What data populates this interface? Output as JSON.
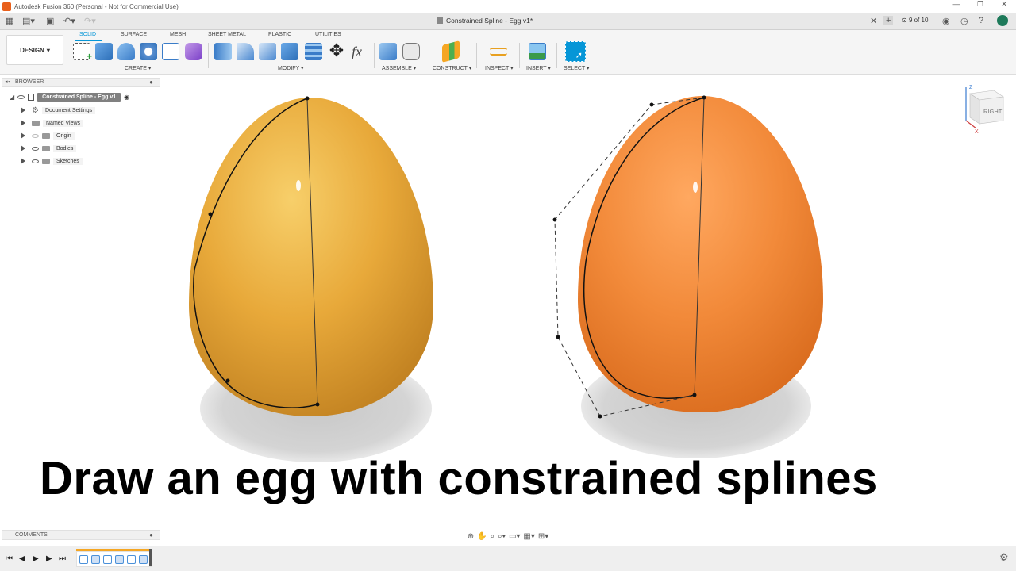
{
  "window": {
    "title": "Autodesk Fusion 360 (Personal - Not for Commercial Use)"
  },
  "document": {
    "tab_title": "Constrained Spline - Egg v1*",
    "pager": "9 of 10"
  },
  "workspace": {
    "design_label": "DESIGN"
  },
  "menu_tabs": [
    "SOLID",
    "SURFACE",
    "MESH",
    "SHEET METAL",
    "PLASTIC",
    "UTILITIES"
  ],
  "groups": {
    "create": "CREATE",
    "modify": "MODIFY",
    "assemble": "ASSEMBLE",
    "construct": "CONSTRUCT",
    "inspect": "INSPECT",
    "insert": "INSERT",
    "select": "SELECT"
  },
  "browser": {
    "header": "BROWSER",
    "root": "Constrained Spline - Egg v1",
    "items": [
      "Document Settings",
      "Named Views",
      "Origin",
      "Bodies",
      "Sketches"
    ]
  },
  "viewcube": {
    "face": "RIGHT",
    "axis_z": "Z",
    "axis_x": "X"
  },
  "caption": "Draw an egg with constrained splines",
  "comments": {
    "header": "COMMENTS"
  },
  "colors": {
    "accent": "#0696d7",
    "egg_left": "#e8a93a",
    "egg_right": "#f28a3a"
  }
}
